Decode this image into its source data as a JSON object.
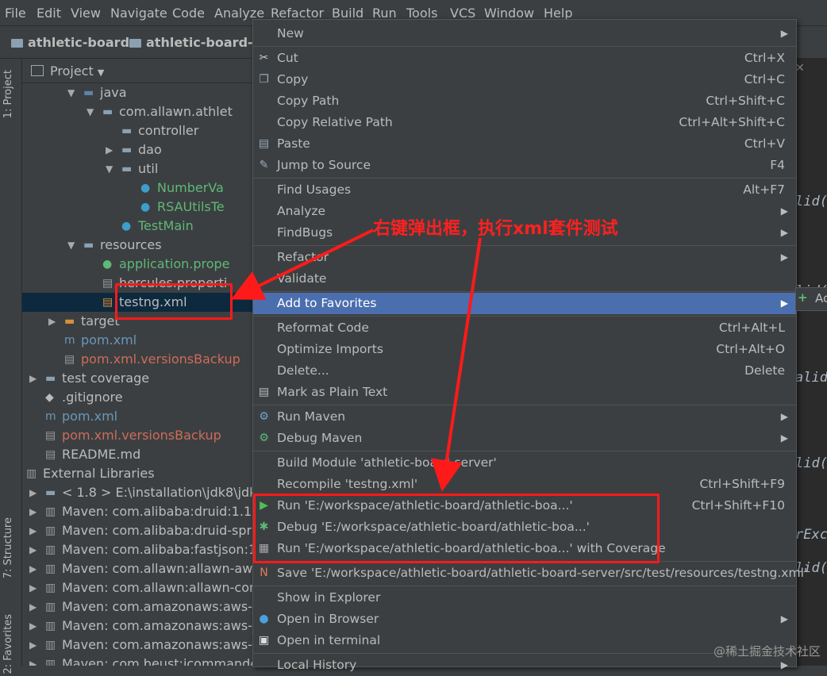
{
  "menubar": [
    "File",
    "Edit",
    "View",
    "Navigate",
    "Code",
    "Analyze",
    "Refactor",
    "Build",
    "Run",
    "Tools",
    "VCS",
    "Window",
    "Help"
  ],
  "breadcrumbs": [
    "athletic-board",
    "athletic-board-ser"
  ],
  "toolwindows": {
    "project_tab": "1: Project",
    "structure_tab": "7: Structure",
    "favorites_tab": "2: Favorites"
  },
  "project": {
    "title": "Project"
  },
  "tree": [
    {
      "label": "java",
      "indent": 1,
      "arrow": "down",
      "icon": "folder-blue"
    },
    {
      "label": "com.allawn.athlet",
      "indent": 2,
      "arrow": "down",
      "icon": "package"
    },
    {
      "label": "controller",
      "indent": 3,
      "arrow": "",
      "icon": "package"
    },
    {
      "label": "dao",
      "indent": 3,
      "arrow": "right",
      "icon": "package"
    },
    {
      "label": "util",
      "indent": 3,
      "arrow": "down",
      "icon": "package"
    },
    {
      "label": "NumberVa",
      "indent": 4,
      "arrow": "",
      "icon": "class",
      "color": "green"
    },
    {
      "label": "RSAUtilsTe",
      "indent": 4,
      "arrow": "",
      "icon": "class",
      "color": "green"
    },
    {
      "label": "TestMain",
      "indent": 3,
      "arrow": "",
      "icon": "class",
      "color": "green"
    },
    {
      "label": "resources",
      "indent": 1,
      "arrow": "down",
      "icon": "folder"
    },
    {
      "label": "application.prope",
      "indent": 2,
      "arrow": "",
      "icon": "spring",
      "color": "green"
    },
    {
      "label": "hercules.properti",
      "indent": 2,
      "arrow": "",
      "icon": "file"
    },
    {
      "label": "testng.xml",
      "indent": 2,
      "arrow": "",
      "icon": "xml",
      "selected": true
    },
    {
      "label": "target",
      "indent": 0,
      "arrow": "right",
      "icon": "folder-orange"
    },
    {
      "label": "pom.xml",
      "indent": 0,
      "arrow": "",
      "icon": "maven",
      "color": "blue"
    },
    {
      "label": "pom.xml.versionsBackup",
      "indent": 0,
      "arrow": "",
      "icon": "file",
      "color": "red"
    },
    {
      "label": "test coverage",
      "indent": -1,
      "arrow": "right",
      "icon": "folder"
    },
    {
      "label": ".gitignore",
      "indent": -1,
      "arrow": "",
      "icon": "git"
    },
    {
      "label": "pom.xml",
      "indent": -1,
      "arrow": "",
      "icon": "maven",
      "color": "blue"
    },
    {
      "label": "pom.xml.versionsBackup",
      "indent": -1,
      "arrow": "",
      "icon": "file",
      "color": "red"
    },
    {
      "label": "README.md",
      "indent": -1,
      "arrow": "",
      "icon": "md"
    },
    {
      "label": "External Libraries",
      "indent": -2,
      "arrow": "down",
      "icon": "lib"
    },
    {
      "label": "< 1.8 >  E:\\installation\\jdk8\\jdk",
      "indent": -1,
      "arrow": "right",
      "icon": "jdk"
    },
    {
      "label": "Maven: com.alibaba:druid:1.1.",
      "indent": -1,
      "arrow": "right",
      "icon": "lib"
    },
    {
      "label": "Maven: com.alibaba:druid-spr",
      "indent": -1,
      "arrow": "right",
      "icon": "lib"
    },
    {
      "label": "Maven: com.alibaba:fastjson:1",
      "indent": -1,
      "arrow": "right",
      "icon": "lib"
    },
    {
      "label": "Maven: com.allawn:allawn-aws",
      "indent": -1,
      "arrow": "right",
      "icon": "lib"
    },
    {
      "label": "Maven: com.allawn:allawn-cor",
      "indent": -1,
      "arrow": "right",
      "icon": "lib"
    },
    {
      "label": "Maven: com.amazonaws:aws-j",
      "indent": -1,
      "arrow": "right",
      "icon": "lib"
    },
    {
      "label": "Maven: com.amazonaws:aws-j",
      "indent": -1,
      "arrow": "right",
      "icon": "lib"
    },
    {
      "label": "Maven: com.amazonaws:aws-j",
      "indent": -1,
      "arrow": "right",
      "icon": "lib"
    },
    {
      "label": "Maven: com.beust:jcommande",
      "indent": -1,
      "arrow": "right",
      "icon": "lib"
    }
  ],
  "editor_fragments": [
    "lid(",
    "lid(",
    "alid",
    "lid(",
    "rExc",
    "lid("
  ],
  "menu": [
    {
      "label": "New",
      "shortcut": "",
      "sub": true,
      "icon": ""
    },
    {
      "sep": true
    },
    {
      "label": "Cut",
      "shortcut": "Ctrl+X",
      "icon": "scissors-icon"
    },
    {
      "label": "Copy",
      "shortcut": "Ctrl+C",
      "icon": "copy-icon"
    },
    {
      "label": "Copy Path",
      "shortcut": "Ctrl+Shift+C",
      "icon": ""
    },
    {
      "label": "Copy Relative Path",
      "shortcut": "Ctrl+Alt+Shift+C",
      "icon": ""
    },
    {
      "label": "Paste",
      "shortcut": "Ctrl+V",
      "icon": "paste-icon"
    },
    {
      "label": "Jump to Source",
      "shortcut": "F4",
      "icon": "jump-icon"
    },
    {
      "sep": true
    },
    {
      "label": "Find Usages",
      "shortcut": "Alt+F7",
      "icon": ""
    },
    {
      "label": "Analyze",
      "shortcut": "",
      "sub": true,
      "icon": ""
    },
    {
      "label": "FindBugs",
      "shortcut": "",
      "sub": true,
      "icon": ""
    },
    {
      "sep": true
    },
    {
      "label": "Refactor",
      "shortcut": "",
      "sub": true,
      "icon": ""
    },
    {
      "label": "Validate",
      "shortcut": "",
      "icon": ""
    },
    {
      "sep": true
    },
    {
      "label": "Add to Favorites",
      "shortcut": "",
      "sub": true,
      "icon": "",
      "highlight": true
    },
    {
      "sep": true
    },
    {
      "label": "Reformat Code",
      "shortcut": "Ctrl+Alt+L",
      "icon": ""
    },
    {
      "label": "Optimize Imports",
      "shortcut": "Ctrl+Alt+O",
      "icon": ""
    },
    {
      "label": "Delete...",
      "shortcut": "Delete",
      "icon": ""
    },
    {
      "label": "Mark as Plain Text",
      "shortcut": "",
      "icon": "plaintext-icon"
    },
    {
      "sep": true
    },
    {
      "label": "Run Maven",
      "shortcut": "",
      "sub": true,
      "icon": "maven-gear-icon"
    },
    {
      "label": "Debug Maven",
      "shortcut": "",
      "sub": true,
      "icon": "maven-debug-icon"
    },
    {
      "sep": true
    },
    {
      "label": "Build Module 'athletic-board-server'",
      "shortcut": "",
      "icon": ""
    },
    {
      "label": "Recompile 'testng.xml'",
      "shortcut": "Ctrl+Shift+F9",
      "icon": ""
    },
    {
      "label": "Run 'E:/workspace/athletic-board/athletic-boa...'",
      "shortcut": "Ctrl+Shift+F10",
      "icon": "run-icon"
    },
    {
      "label": "Debug 'E:/workspace/athletic-board/athletic-boa...'",
      "shortcut": "",
      "icon": "debug-icon"
    },
    {
      "label": "Run 'E:/workspace/athletic-board/athletic-boa...' with Coverage",
      "shortcut": "",
      "icon": "coverage-icon"
    },
    {
      "sep": true
    },
    {
      "label": "Save 'E:/workspace/athletic-board/athletic-board-server/src/test/resources/testng.xml'",
      "shortcut": "",
      "icon": "testng-icon"
    },
    {
      "sep": true
    },
    {
      "label": "Show in Explorer",
      "shortcut": "",
      "icon": ""
    },
    {
      "label": "Open in Browser",
      "shortcut": "",
      "sub": true,
      "icon": "globe-icon"
    },
    {
      "label": "Open in terminal",
      "shortcut": "",
      "icon": "terminal-icon"
    },
    {
      "sep": true
    },
    {
      "label": "Local History",
      "shortcut": "",
      "sub": true,
      "icon": ""
    }
  ],
  "submenu_label": "Ac",
  "annotation": "右键弹出框，执行xml套件测试",
  "watermark": "@稀土掘金技术社区",
  "colors": {
    "highlight": "#4b6eaf",
    "annotation": "#ff1a1a",
    "selection": "#0d293e"
  }
}
